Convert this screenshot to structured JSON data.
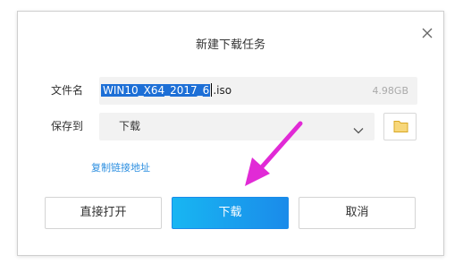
{
  "dialog": {
    "title": "新建下载任务",
    "close_icon": "close-icon"
  },
  "filename": {
    "label": "文件名",
    "selected_text": "WIN10_X64_2017_6",
    "rest_text": ".iso",
    "size": "4.98GB"
  },
  "save_to": {
    "label": "保存到",
    "value": "下载",
    "dropdown_icon": "chevron-down-icon",
    "folder_icon": "folder-icon"
  },
  "copy_link": "复制链接地址",
  "buttons": {
    "open_directly": "直接打开",
    "download": "下载",
    "cancel": "取消"
  },
  "colors": {
    "primary_button": "#1a8bea",
    "selection": "#1d6fd6",
    "link": "#2d8fe0",
    "annotation_arrow": "#e12ad6",
    "folder": "#f3c54a"
  },
  "annotation_icon": "pointer-arrow-icon"
}
